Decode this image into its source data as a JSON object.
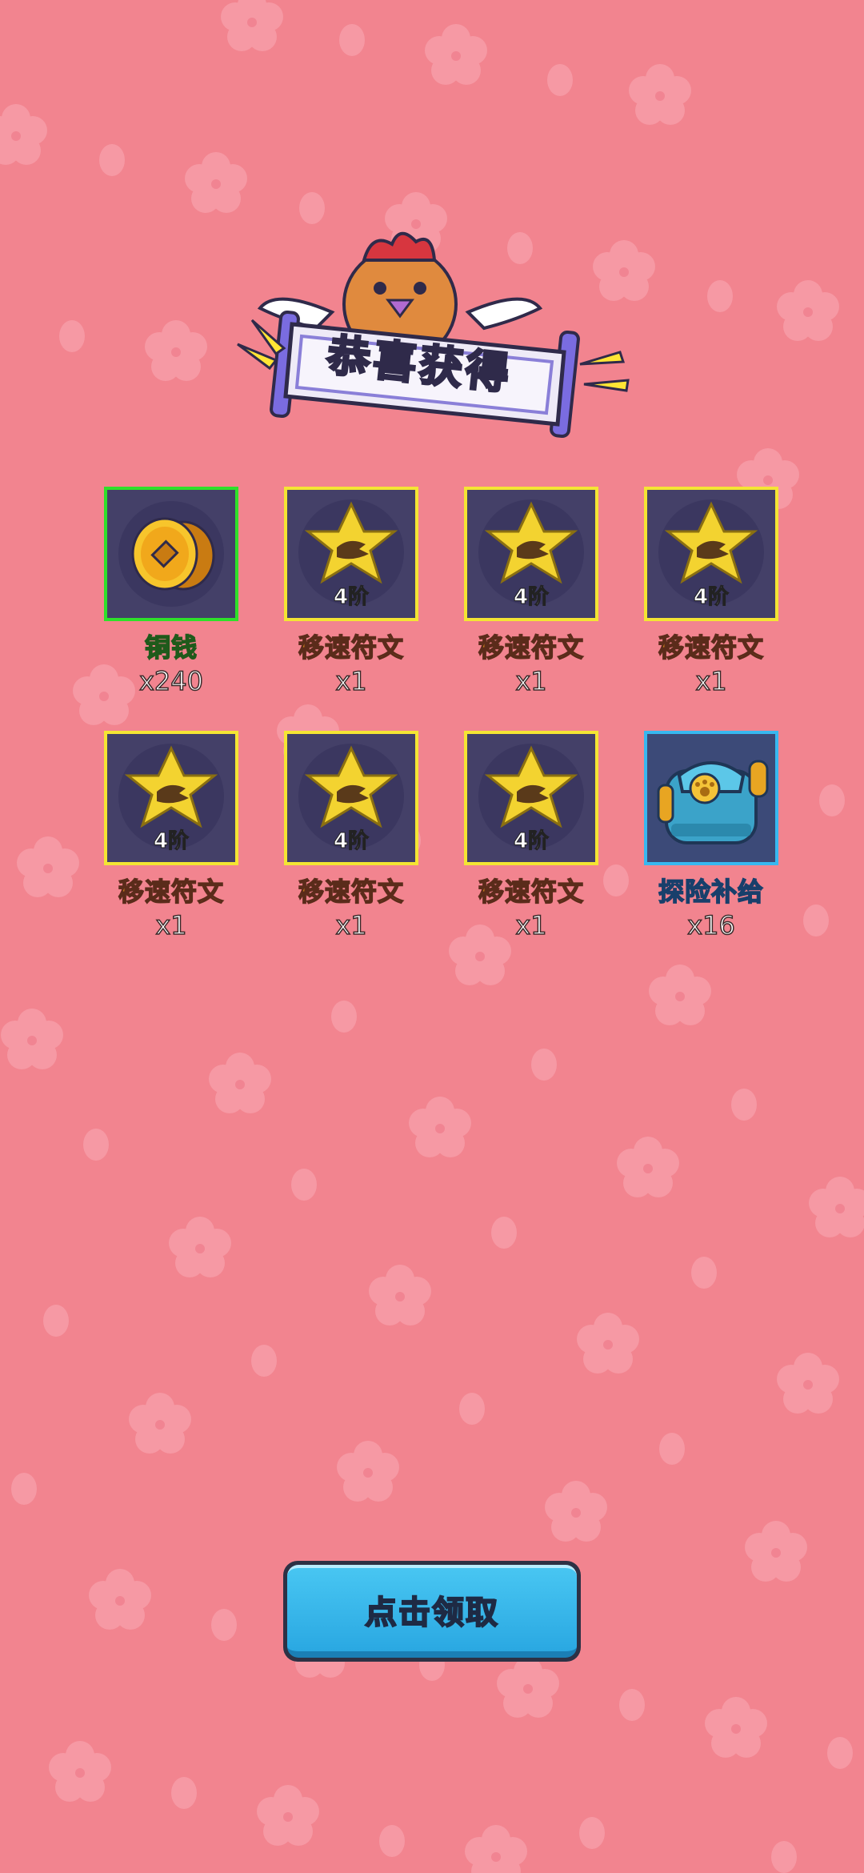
{
  "header": {
    "title": "恭喜获得"
  },
  "rewards": [
    {
      "name": "铜钱",
      "count": "x240",
      "icon": "copper-coin-icon",
      "tier": "",
      "rarity_color": "#2ee02a"
    },
    {
      "name": "移速符文",
      "count": "x1",
      "icon": "speed-rune-icon",
      "tier": "4阶",
      "rarity_color": "#f4e533"
    },
    {
      "name": "移速符文",
      "count": "x1",
      "icon": "speed-rune-icon",
      "tier": "4阶",
      "rarity_color": "#f4e533"
    },
    {
      "name": "移速符文",
      "count": "x1",
      "icon": "speed-rune-icon",
      "tier": "4阶",
      "rarity_color": "#f4e533"
    },
    {
      "name": "移速符文",
      "count": "x1",
      "icon": "speed-rune-icon",
      "tier": "4阶",
      "rarity_color": "#f4e533"
    },
    {
      "name": "移速符文",
      "count": "x1",
      "icon": "speed-rune-icon",
      "tier": "4阶",
      "rarity_color": "#f4e533"
    },
    {
      "name": "移速符文",
      "count": "x1",
      "icon": "speed-rune-icon",
      "tier": "4阶",
      "rarity_color": "#f4e533"
    },
    {
      "name": "探险补给",
      "count": "x16",
      "icon": "backpack-icon",
      "tier": "",
      "rarity_color": "#37b8f0"
    }
  ],
  "claim_button": {
    "label": "点击领取"
  },
  "colors": {
    "background": "#f2848f",
    "title_green": "#8bd600",
    "button_blue": "#2aa8e2"
  }
}
